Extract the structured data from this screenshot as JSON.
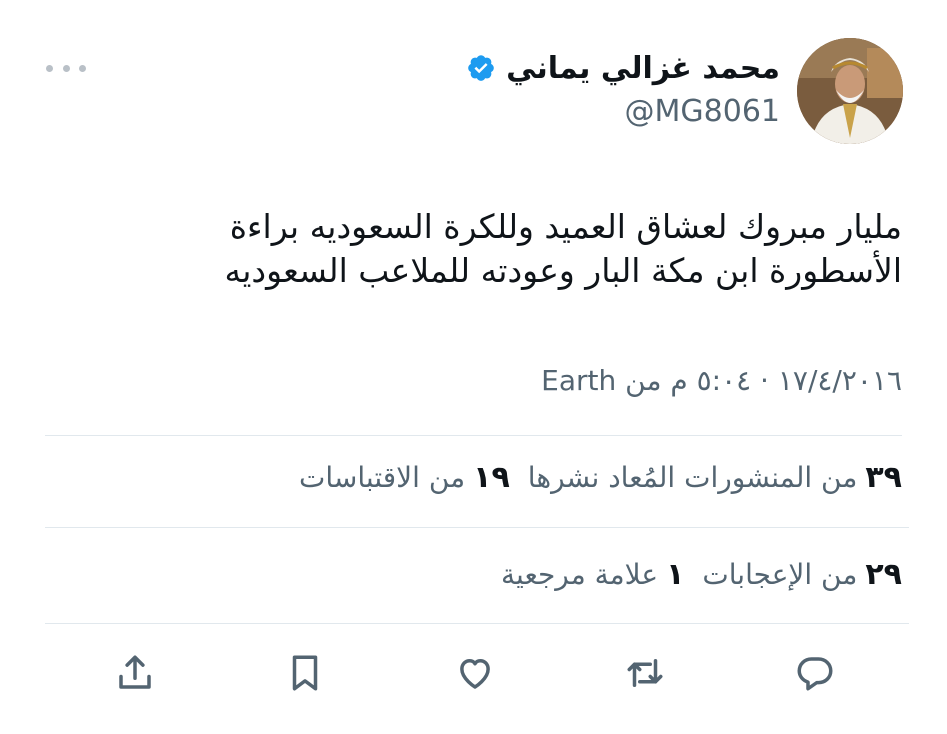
{
  "tweet": {
    "author_name": "محمد غزالي يماني",
    "handle": "@MG8061",
    "text_line1": "مليار مبروك لعشاق العميد وللكرة السعوديه براءة",
    "text_line2": "الأسطورة ابن مكة البار  وعودته للملاعب السعوديه",
    "meta": "١٧/٤/٢٠١٦ · ٥:٠٤ م من Earth"
  },
  "stats": {
    "reposts_count": "٣٩",
    "reposts_label": "من المنشورات المُعاد نشرها",
    "quotes_count": "١٩",
    "quotes_label": "من الاقتباسات",
    "likes_count": "٢٩",
    "likes_label": "من الإعجابات",
    "bookmarks_count": "١",
    "bookmarks_label": "علامة مرجعية"
  },
  "colors": {
    "verified_blue": "#1d9bf0",
    "muted_text": "#536471",
    "primary_text": "#0f1419",
    "divider": "#e1e8ed"
  },
  "icons": {
    "more": "more-horizontal-icon",
    "verified": "verified-badge-icon",
    "reply": "reply-icon",
    "retweet": "retweet-icon",
    "like": "heart-icon",
    "bookmark": "bookmark-icon",
    "share": "share-icon"
  }
}
